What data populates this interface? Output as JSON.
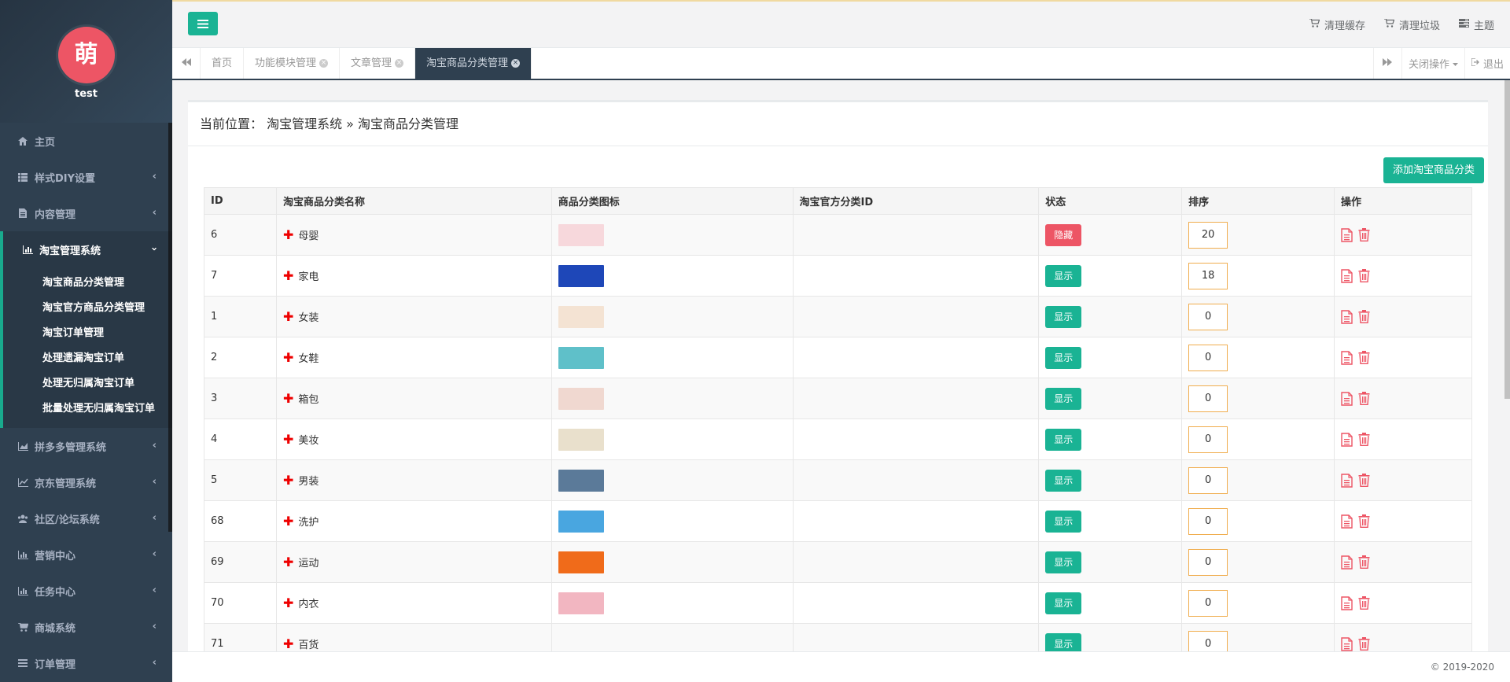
{
  "profile": {
    "avatar_char": "萌",
    "username": "test"
  },
  "sidebar": {
    "items": [
      {
        "label": "主页",
        "icon": "home-icon"
      },
      {
        "label": "样式DIY设置",
        "icon": "list-icon"
      },
      {
        "label": "内容管理",
        "icon": "file-icon"
      },
      {
        "label": "淘宝管理系统",
        "icon": "bar-chart-icon"
      },
      {
        "label": "拼多多管理系统",
        "icon": "area-chart-icon"
      },
      {
        "label": "京东管理系统",
        "icon": "line-chart-icon"
      },
      {
        "label": "社区/论坛系统",
        "icon": "users-icon"
      },
      {
        "label": "营销中心",
        "icon": "bar-chart-icon"
      },
      {
        "label": "任务中心",
        "icon": "bar-chart-icon"
      },
      {
        "label": "商城系统",
        "icon": "cart-icon"
      },
      {
        "label": "订单管理",
        "icon": "menu-icon"
      }
    ],
    "subitems": [
      "淘宝商品分类管理",
      "淘宝官方商品分类管理",
      "淘宝订单管理",
      "处理遗漏淘宝订单",
      "处理无归属淘宝订单",
      "批量处理无归属淘宝订单"
    ]
  },
  "topbar": {
    "clear_cache": "清理缓存",
    "clear_trash": "清理垃圾",
    "theme": "主题"
  },
  "tabs": [
    {
      "label": "首页"
    },
    {
      "label": "功能模块管理"
    },
    {
      "label": "文章管理"
    },
    {
      "label": "淘宝商品分类管理"
    }
  ],
  "tabs_right": {
    "close_ops": "关闭操作",
    "logout": "退出"
  },
  "panel": {
    "breadcrumb": "当前位置： 淘宝管理系统 » 淘宝商品分类管理",
    "add_button": "添加淘宝商品分类"
  },
  "table": {
    "headers": [
      "ID",
      "淘宝商品分类名称",
      "商品分类图标",
      "淘宝官方分类ID",
      "状态",
      "排序",
      "操作"
    ],
    "rows": [
      {
        "id": "6",
        "name": "母婴",
        "status": "隐藏",
        "sort": "20",
        "thumb_color": "#f7d8dc"
      },
      {
        "id": "7",
        "name": "家电",
        "status": "显示",
        "sort": "18",
        "thumb_color": "#1e47b8"
      },
      {
        "id": "1",
        "name": "女装",
        "status": "显示",
        "sort": "0",
        "thumb_color": "#f4e3d3"
      },
      {
        "id": "2",
        "name": "女鞋",
        "status": "显示",
        "sort": "0",
        "thumb_color": "#5fc0c9"
      },
      {
        "id": "3",
        "name": "箱包",
        "status": "显示",
        "sort": "0",
        "thumb_color": "#f0d8d0"
      },
      {
        "id": "4",
        "name": "美妆",
        "status": "显示",
        "sort": "0",
        "thumb_color": "#e9e0cc"
      },
      {
        "id": "5",
        "name": "男装",
        "status": "显示",
        "sort": "0",
        "thumb_color": "#5b7a99"
      },
      {
        "id": "68",
        "name": "洗护",
        "status": "显示",
        "sort": "0",
        "thumb_color": "#49a6e0"
      },
      {
        "id": "69",
        "name": "运动",
        "status": "显示",
        "sort": "0",
        "thumb_color": "#f06b1a"
      },
      {
        "id": "70",
        "name": "内衣",
        "status": "显示",
        "sort": "0",
        "thumb_color": "#f2b6c1"
      },
      {
        "id": "71",
        "name": "百货",
        "status": "显示",
        "sort": "0",
        "thumb_color": ""
      }
    ]
  },
  "footer": {
    "copyright": "© 2019-2020"
  },
  "colors": {
    "sidebar_bg": "#2f4050",
    "accent": "#1ab394",
    "danger": "#ed5565"
  }
}
